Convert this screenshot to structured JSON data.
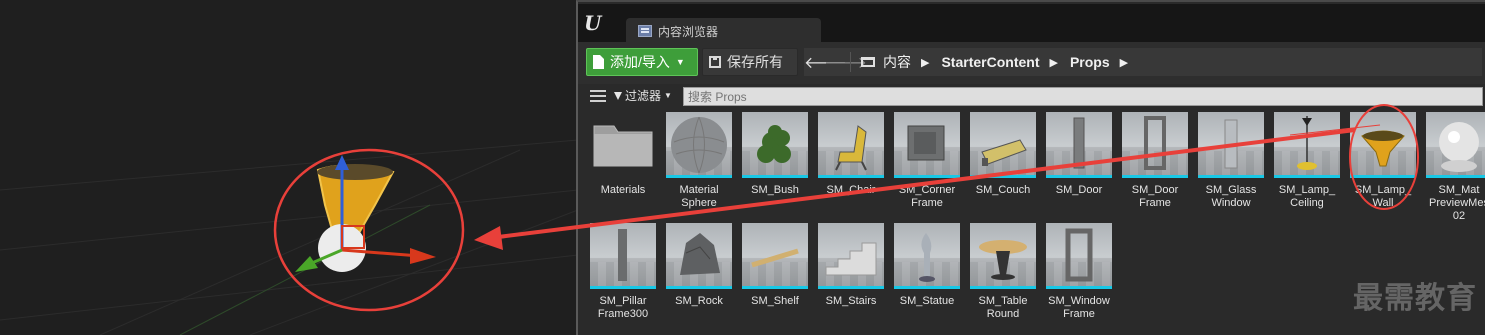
{
  "window": {
    "tab_label": "内容浏览器"
  },
  "toolbar": {
    "add_import_label": "添加/导入",
    "save_all_label": "保存所有"
  },
  "breadcrumb": {
    "items": [
      "内容",
      "StarterContent",
      "Props"
    ]
  },
  "filterbar": {
    "filters_label": "过滤器",
    "search_placeholder": "搜索 Props"
  },
  "assets": [
    {
      "label": "Materials",
      "kind": "folder"
    },
    {
      "label": "Material\nSphere",
      "kind": "sphere"
    },
    {
      "label": "SM_Bush",
      "kind": "bush"
    },
    {
      "label": "SM_Chair",
      "kind": "chair"
    },
    {
      "label": "SM_Corner\nFrame",
      "kind": "corner"
    },
    {
      "label": "SM_Couch",
      "kind": "couch"
    },
    {
      "label": "SM_Door",
      "kind": "door"
    },
    {
      "label": "SM_Door\nFrame",
      "kind": "doorframe"
    },
    {
      "label": "SM_Glass\nWindow",
      "kind": "glass"
    },
    {
      "label": "SM_Lamp_\nCeiling",
      "kind": "lampceiling"
    },
    {
      "label": "SM_Lamp_\nWall",
      "kind": "lampwall"
    },
    {
      "label": "SM_Mat\nPreviewMes\n02",
      "kind": "matpreview"
    },
    {
      "label": "SM_Pillar\nFrame300",
      "kind": "pillar"
    },
    {
      "label": "SM_Rock",
      "kind": "rock"
    },
    {
      "label": "SM_Shelf",
      "kind": "shelf"
    },
    {
      "label": "SM_Stairs",
      "kind": "stairs"
    },
    {
      "label": "SM_Statue",
      "kind": "statue"
    },
    {
      "label": "SM_Table\nRound",
      "kind": "table"
    },
    {
      "label": "SM_Window\nFrame",
      "kind": "windowframe"
    }
  ],
  "watermark": "最需教育",
  "colors": {
    "add_button": "#3e9e3a",
    "thumbnail_underline": "#18c8e6",
    "annotation": "#e8403a"
  }
}
